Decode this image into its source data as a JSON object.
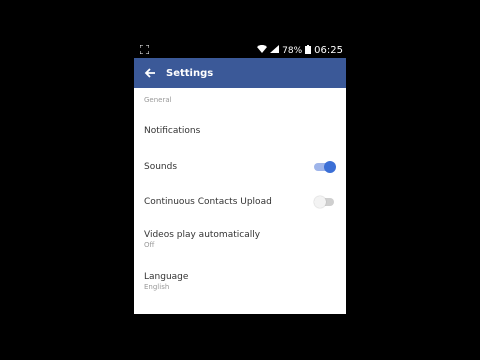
{
  "status_bar": {
    "battery": "78%",
    "time": "06:25"
  },
  "app_bar": {
    "title": "Settings"
  },
  "section": {
    "header": "General"
  },
  "rows": [
    {
      "label": "Notifications"
    },
    {
      "label": "Sounds",
      "toggle": true
    },
    {
      "label": "Continuous Contacts Upload",
      "toggle": false
    },
    {
      "label": "Videos play automatically",
      "sub": "Off"
    },
    {
      "label": "Language",
      "sub": "English"
    }
  ],
  "colors": {
    "app_bar": "#3b5998",
    "toggle_on": "#3b6fd6"
  }
}
